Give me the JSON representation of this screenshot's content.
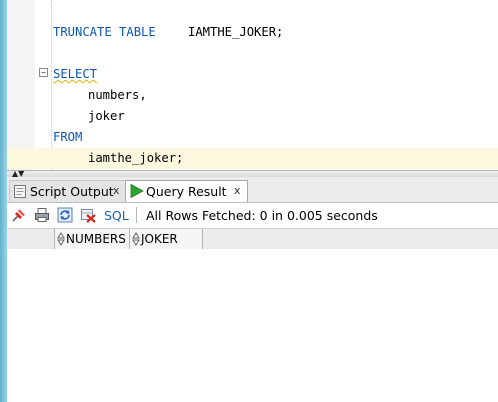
{
  "editor": {
    "lines": [
      {
        "keyword": "TRUNCATE TABLE",
        "ident": "IAMTHE_JOKER;"
      },
      {
        "keyword": "SELECT"
      },
      {
        "ident": "numbers,"
      },
      {
        "ident": "joker"
      },
      {
        "keyword": "FROM"
      },
      {
        "ident": "iamthe_joker;"
      }
    ],
    "fold_symbol": "−",
    "scroll_up": "▲",
    "scroll_down": "▼"
  },
  "tabs": [
    {
      "label": "Script Output",
      "close": "x",
      "icon": "script-output-icon"
    },
    {
      "label": "Query Result",
      "close": "x",
      "icon": "run-triangle-icon"
    }
  ],
  "toolbar": {
    "sql_label": "SQL",
    "status": "All Rows Fetched: 0 in 0.005 seconds",
    "icons": [
      "pin-icon",
      "print-icon",
      "refresh-icon",
      "delete-icon"
    ]
  },
  "grid": {
    "columns": [
      "NUMBERS",
      "JOKER"
    ],
    "rows": []
  },
  "colors": {
    "keyword": "#0b57b6",
    "current_line": "#fcf8dd",
    "accent_stripe": "#5fb2cf",
    "run_icon": "#2fa32f"
  }
}
